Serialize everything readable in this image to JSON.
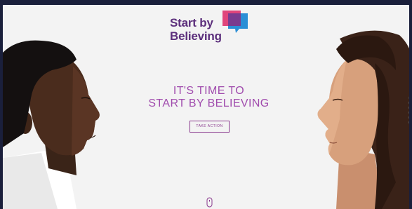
{
  "logo": {
    "line1": "Start by",
    "line2": "Believing",
    "colors": {
      "text": "#5c2f7c",
      "pink": "#e0457b",
      "purple": "#7a3b8f",
      "blue": "#2b8fd6"
    }
  },
  "hero": {
    "line1": "IT'S TIME TO",
    "line2": "START BY BELIEVING",
    "cta_label": "TAKE ACTION"
  },
  "colors": {
    "accent": "#a04bad",
    "border": "#1a1f3b",
    "background": "#f3f3f3"
  },
  "pagination": {
    "count": 6,
    "active_index": 0
  },
  "icons": {
    "scroll": "mouse-scroll-icon"
  }
}
